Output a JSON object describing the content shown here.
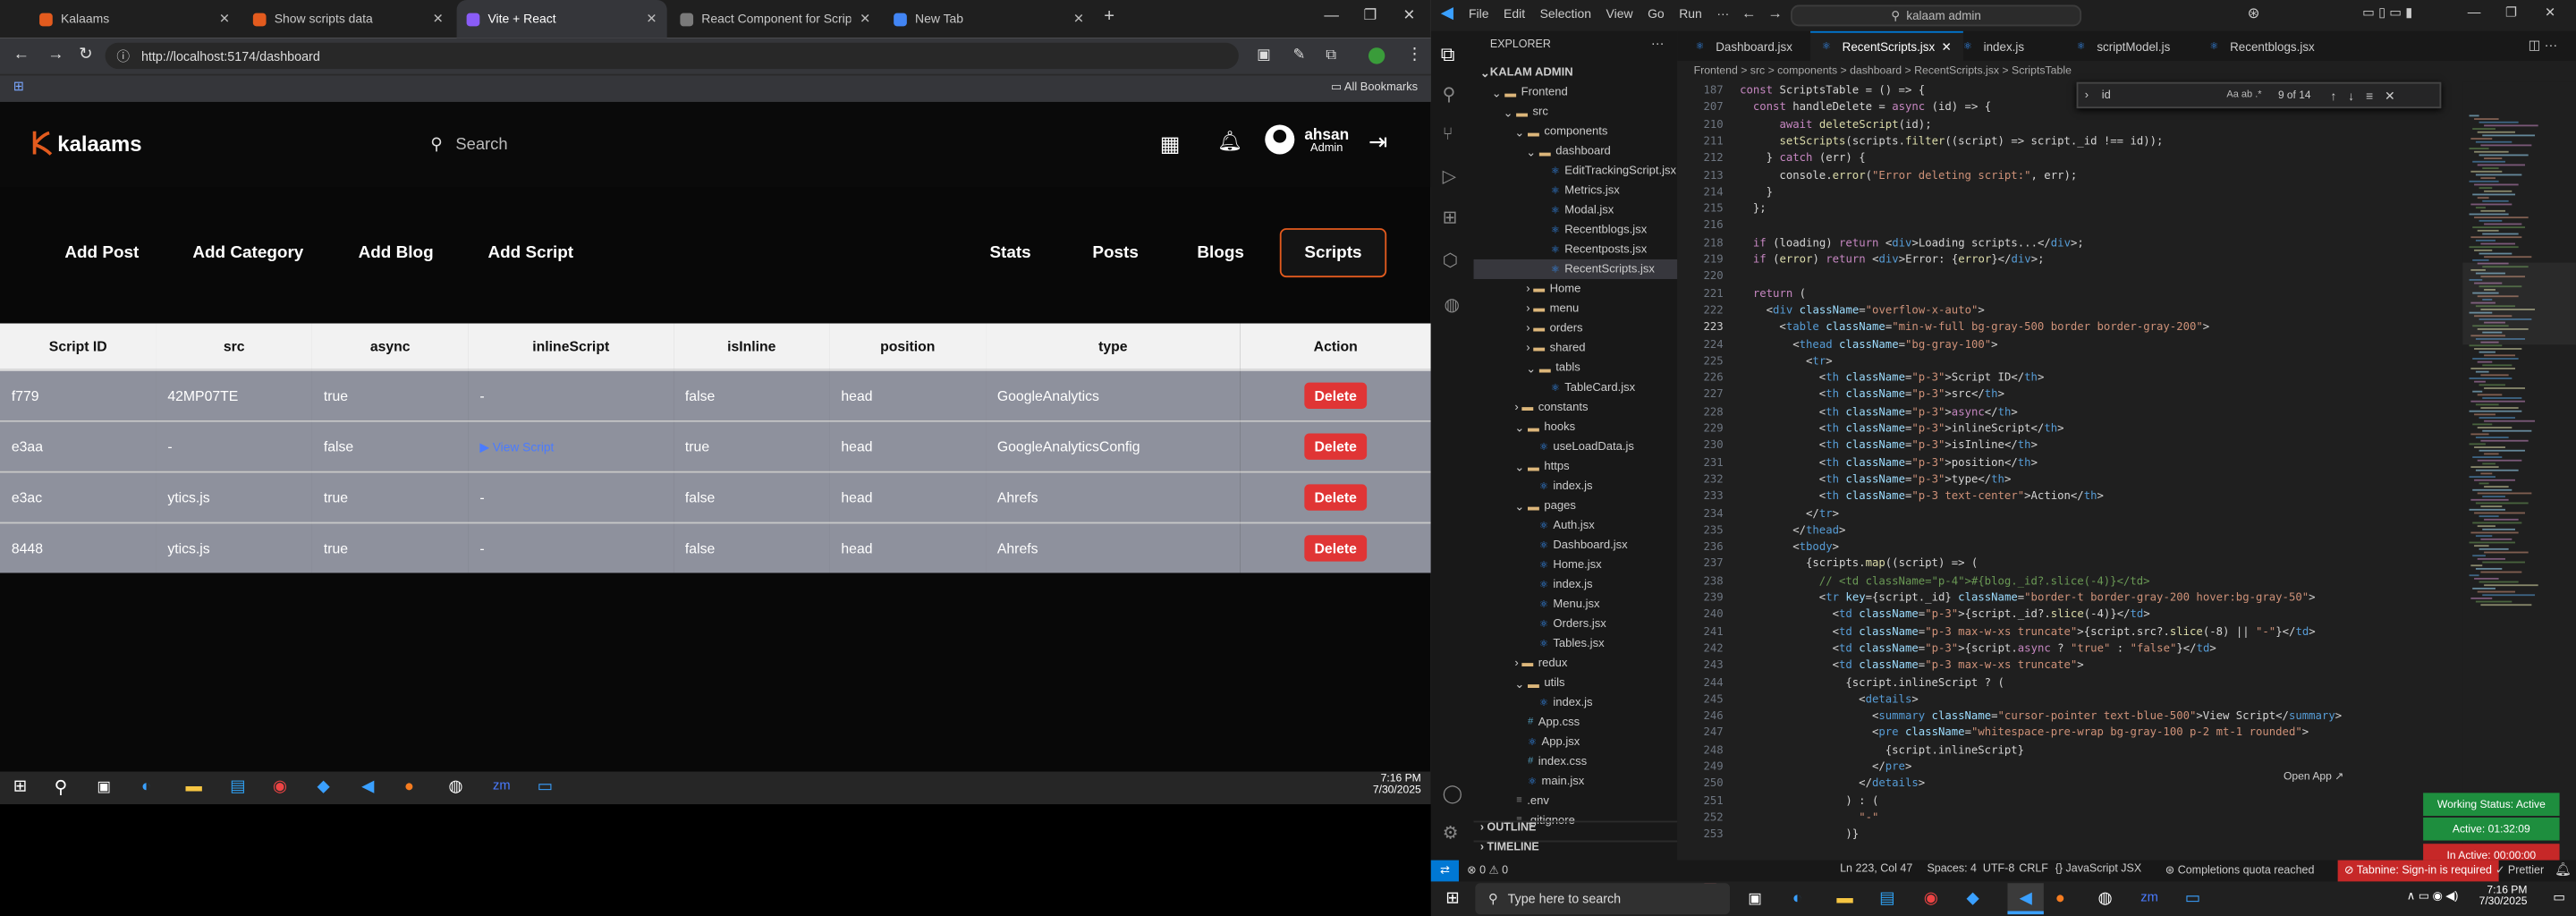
{
  "browser": {
    "tabs": [
      {
        "label": "Kalaams",
        "color": "#e35b1e"
      },
      {
        "label": "Show scripts data",
        "color": "#e35b1e"
      },
      {
        "label": "Vite + React",
        "color": "#8a5cf6"
      },
      {
        "label": "React Component for Script Da",
        "color": "#7a7a7a"
      },
      {
        "label": "New Tab",
        "color": "#4285f4"
      }
    ],
    "url": "http://localhost:5174/dashboard",
    "bookmarks_label": "All Bookmarks"
  },
  "app": {
    "logo": "kalaams",
    "search_placeholder": "Search",
    "user_name": "ahsan",
    "user_role": "Admin",
    "nav_left": [
      "Add Post",
      "Add Category",
      "Add Blog",
      "Add Script"
    ],
    "nav_right": [
      "Stats",
      "Posts",
      "Blogs",
      "Scripts"
    ],
    "table": {
      "headers": [
        "Script ID",
        "src",
        "async",
        "inlineScript",
        "isInline",
        "position",
        "type",
        "Action"
      ],
      "rows": [
        [
          "f779",
          "42MP07TE",
          "true",
          "-",
          "false",
          "head",
          "GoogleAnalytics"
        ],
        [
          "e3aa",
          "-",
          "false",
          "▶ View Script",
          "true",
          "head",
          "GoogleAnalyticsConfig"
        ],
        [
          "e3ac",
          "ytics.js",
          "true",
          "-",
          "false",
          "head",
          "Ahrefs"
        ],
        [
          "8448",
          "ytics.js",
          "true",
          "-",
          "false",
          "head",
          "Ahrefs"
        ]
      ],
      "delete_label": "Delete"
    }
  },
  "taskbar_left": {
    "time": "7:16 PM",
    "date": "7/30/2025"
  },
  "vscode": {
    "menu": [
      "File",
      "Edit",
      "Selection",
      "View",
      "Go",
      "Run",
      "···"
    ],
    "command_center": "kalaam admin",
    "explorer_title": "EXPLORER",
    "tree": [
      {
        "label": "KALAM ADMIN",
        "indent": 0,
        "kind": "root"
      },
      {
        "label": "Frontend",
        "indent": 1,
        "kind": "open"
      },
      {
        "label": "src",
        "indent": 2,
        "kind": "open"
      },
      {
        "label": "components",
        "indent": 3,
        "kind": "open"
      },
      {
        "label": "dashboard",
        "indent": 4,
        "kind": "open"
      },
      {
        "label": "EditTrackingScript.jsx",
        "indent": 5,
        "kind": "jsx"
      },
      {
        "label": "Metrics.jsx",
        "indent": 5,
        "kind": "jsx"
      },
      {
        "label": "Modal.jsx",
        "indent": 5,
        "kind": "jsx"
      },
      {
        "label": "Recentblogs.jsx",
        "indent": 5,
        "kind": "jsx"
      },
      {
        "label": "Recentposts.jsx",
        "indent": 5,
        "kind": "jsx"
      },
      {
        "label": "RecentScripts.jsx",
        "indent": 5,
        "kind": "jsx",
        "selected": true
      },
      {
        "label": "Home",
        "indent": 4,
        "kind": "closed"
      },
      {
        "label": "menu",
        "indent": 4,
        "kind": "closed"
      },
      {
        "label": "orders",
        "indent": 4,
        "kind": "closed"
      },
      {
        "label": "shared",
        "indent": 4,
        "kind": "closed"
      },
      {
        "label": "tabls",
        "indent": 4,
        "kind": "open"
      },
      {
        "label": "TableCard.jsx",
        "indent": 5,
        "kind": "jsx"
      },
      {
        "label": "constants",
        "indent": 3,
        "kind": "closed"
      },
      {
        "label": "hooks",
        "indent": 3,
        "kind": "open"
      },
      {
        "label": "useLoadData.js",
        "indent": 4,
        "kind": "js"
      },
      {
        "label": "https",
        "indent": 3,
        "kind": "open"
      },
      {
        "label": "index.js",
        "indent": 4,
        "kind": "js"
      },
      {
        "label": "pages",
        "indent": 3,
        "kind": "open"
      },
      {
        "label": "Auth.jsx",
        "indent": 4,
        "kind": "jsx"
      },
      {
        "label": "Dashboard.jsx",
        "indent": 4,
        "kind": "jsx"
      },
      {
        "label": "Home.jsx",
        "indent": 4,
        "kind": "jsx"
      },
      {
        "label": "index.js",
        "indent": 4,
        "kind": "js"
      },
      {
        "label": "Menu.jsx",
        "indent": 4,
        "kind": "jsx"
      },
      {
        "label": "Orders.jsx",
        "indent": 4,
        "kind": "jsx"
      },
      {
        "label": "Tables.jsx",
        "indent": 4,
        "kind": "jsx"
      },
      {
        "label": "redux",
        "indent": 3,
        "kind": "closed"
      },
      {
        "label": "utils",
        "indent": 3,
        "kind": "open"
      },
      {
        "label": "index.js",
        "indent": 4,
        "kind": "js"
      },
      {
        "label": "App.css",
        "indent": 3,
        "kind": "css"
      },
      {
        "label": "App.jsx",
        "indent": 3,
        "kind": "jsx"
      },
      {
        "label": "index.css",
        "indent": 3,
        "kind": "css"
      },
      {
        "label": "main.jsx",
        "indent": 3,
        "kind": "jsx"
      },
      {
        "label": ".env",
        "indent": 2,
        "kind": "env"
      },
      {
        "label": ".gitignore",
        "indent": 2,
        "kind": "env"
      }
    ],
    "outline_label": "OUTLINE",
    "timeline_label": "TIMELINE",
    "editor_tabs": [
      {
        "label": "Dashboard.jsx"
      },
      {
        "label": "RecentScripts.jsx",
        "active": true
      },
      {
        "label": "index.js"
      },
      {
        "label": "scriptModel.js"
      },
      {
        "label": "Recentblogs.jsx"
      }
    ],
    "breadcrumb": "Frontend > src > components > dashboard > RecentScripts.jsx > ScriptsTable",
    "find": {
      "value": "id",
      "count": "9 of 14"
    },
    "code": [
      {
        "n": "187",
        "t": "const ScriptsTable = () => {"
      },
      {
        "n": "207",
        "t": "  const handleDelete = async (id) => {"
      },
      {
        "n": "210",
        "t": "      await deleteScript(id);"
      },
      {
        "n": "211",
        "t": "      setScripts(scripts.filter((script) => script._id !== id));"
      },
      {
        "n": "212",
        "t": "    } catch (err) {"
      },
      {
        "n": "213",
        "t": "      console.error(\"Error deleting script:\", err);"
      },
      {
        "n": "214",
        "t": "    }"
      },
      {
        "n": "215",
        "t": "  };"
      },
      {
        "n": "216",
        "t": ""
      },
      {
        "n": "218",
        "t": "  if (loading) return <div>Loading scripts...</div>;"
      },
      {
        "n": "219",
        "t": "  if (error) return <div>Error: {error}</div>;"
      },
      {
        "n": "220",
        "t": ""
      },
      {
        "n": "221",
        "t": "  return ("
      },
      {
        "n": "222",
        "t": "    <div className=\"overflow-x-auto\">"
      },
      {
        "n": "223",
        "t": "      <table className=\"min-w-full bg-gray-500 border border-gray-200\">"
      },
      {
        "n": "224",
        "t": "        <thead className=\"bg-gray-100\">"
      },
      {
        "n": "225",
        "t": "          <tr>"
      },
      {
        "n": "226",
        "t": "            <th className=\"p-3\">Script ID</th>"
      },
      {
        "n": "227",
        "t": "            <th className=\"p-3\">src</th>"
      },
      {
        "n": "228",
        "t": "            <th className=\"p-3\">async</th>"
      },
      {
        "n": "229",
        "t": "            <th className=\"p-3\">inlineScript</th>"
      },
      {
        "n": "230",
        "t": "            <th className=\"p-3\">isInline</th>"
      },
      {
        "n": "231",
        "t": "            <th className=\"p-3\">position</th>"
      },
      {
        "n": "232",
        "t": "            <th className=\"p-3\">type</th>"
      },
      {
        "n": "233",
        "t": "            <th className=\"p-3 text-center\">Action</th>"
      },
      {
        "n": "234",
        "t": "          </tr>"
      },
      {
        "n": "235",
        "t": "        </thead>"
      },
      {
        "n": "236",
        "t": "        <tbody>"
      },
      {
        "n": "237",
        "t": "          {scripts.map((script) => ("
      },
      {
        "n": "238",
        "t": "            // <td className=\"p-4\">#{blog._id?.slice(-4)}</td>"
      },
      {
        "n": "239",
        "t": "            <tr key={script._id} className=\"border-t border-gray-200 hover:bg-gray-50\">"
      },
      {
        "n": "240",
        "t": "              <td className=\"p-3\">{script._id?.slice(-4)}</td>"
      },
      {
        "n": "241",
        "t": "              <td className=\"p-3 max-w-xs truncate\">{script.src?.slice(-8) || \"-\"}</td>"
      },
      {
        "n": "242",
        "t": "              <td className=\"p-3\">{script.async ? \"true\" : \"false\"}</td>"
      },
      {
        "n": "243",
        "t": "              <td className=\"p-3 max-w-xs truncate\">"
      },
      {
        "n": "244",
        "t": "                {script.inlineScript ? ("
      },
      {
        "n": "245",
        "t": "                  <details>"
      },
      {
        "n": "246",
        "t": "                    <summary className=\"cursor-pointer text-blue-500\">View Script</summary>"
      },
      {
        "n": "247",
        "t": "                    <pre className=\"whitespace-pre-wrap bg-gray-100 p-2 mt-1 rounded\">"
      },
      {
        "n": "248",
        "t": "                      {script.inlineScript}"
      },
      {
        "n": "249",
        "t": "                    </pre>"
      },
      {
        "n": "250",
        "t": "                  </details>"
      },
      {
        "n": "251",
        "t": "                ) : ("
      },
      {
        "n": "252",
        "t": "                  \"-\""
      },
      {
        "n": "253",
        "t": "                )}"
      }
    ],
    "status": {
      "errors": "⊗ 0  ⚠ 0",
      "position": "Ln 223, Col 47",
      "spaces": "Spaces: 4",
      "encoding": "UTF-8",
      "eol": "CRLF",
      "language": "JavaScript JSX",
      "quota": "Completions quota reached",
      "tabnine": "Tabnine: Sign-in is required",
      "prettier": "Prettier"
    },
    "open_app": "Open App ↗",
    "working": [
      {
        "label": "Working Status: Active",
        "color": "#1e8e3e"
      },
      {
        "label": "Active: 01:32:09",
        "color": "#1e8e3e"
      },
      {
        "label": "In Active: 00:00:00",
        "color": "#c62828"
      }
    ]
  },
  "taskbar_right": {
    "search": "Type here to search",
    "time": "7:16 PM",
    "date": "7/30/2025"
  }
}
